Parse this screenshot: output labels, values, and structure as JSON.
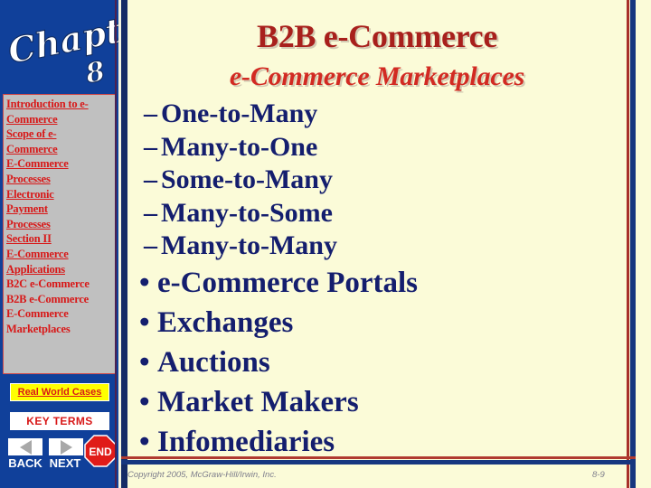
{
  "colors": {
    "sidebar_blue": "#10409a",
    "toc_background": "#c0c0c0",
    "link_red": "#d81818",
    "title_dark_red": "#a8201c",
    "subtitle_red": "#d22a22",
    "bullet_navy": "#141e6e",
    "slide_background": "#fbfbd8",
    "highlight_yellow": "#ffff00",
    "end_button_red": "#e01b18"
  },
  "sidebar": {
    "chapter_art": {
      "word": "Chapter",
      "number": "8",
      "icon": "chapter-script-art"
    },
    "toc_items": [
      {
        "label": "Introduction to e-",
        "underlined": true
      },
      {
        "label": "Commerce",
        "underlined": true
      },
      {
        "label": "Scope of e-",
        "underlined": true
      },
      {
        "label": "Commerce",
        "underlined": true
      },
      {
        "label": "E-Commerce",
        "underlined": true
      },
      {
        "label": "Processes",
        "underlined": true
      },
      {
        "label": "Electronic",
        "underlined": true
      },
      {
        "label": "Payment",
        "underlined": true
      },
      {
        "label": "Processes",
        "underlined": true
      },
      {
        "label": "Section II",
        "underlined": true
      },
      {
        "label": "E-Commerce",
        "underlined": true
      },
      {
        "label": "Applications",
        "underlined": true
      },
      {
        "label": "B2C e-Commerce",
        "underlined": false
      },
      {
        "label": "B2B e-Commerce",
        "underlined": false
      },
      {
        "label": "E-Commerce",
        "underlined": false
      },
      {
        "label": "Marketplaces",
        "underlined": false
      }
    ],
    "real_world_cases_label": "Real World Cases",
    "key_terms_label": "KEY TERMS",
    "back_label": "BACK",
    "next_label": "NEXT",
    "end_label": "END",
    "back_icon": "triangle-left-icon",
    "next_icon": "triangle-right-icon",
    "end_icon": "stop-octagon-icon"
  },
  "content": {
    "title": "B2B e-Commerce",
    "subtitle": "e-Commerce Marketplaces",
    "sub_items": [
      {
        "marker": "–",
        "label": "One-to-Many"
      },
      {
        "marker": "–",
        "label": "Many-to-One"
      },
      {
        "marker": "–",
        "label": "Some-to-Many"
      },
      {
        "marker": "–",
        "label": "Many-to-Some"
      },
      {
        "marker": "–",
        "label": "Many-to-Many"
      }
    ],
    "main_items": [
      {
        "marker": "•",
        "label": "e-Commerce Portals"
      },
      {
        "marker": "•",
        "label": "Exchanges"
      },
      {
        "marker": "•",
        "label": "Auctions"
      },
      {
        "marker": "•",
        "label": "Market Makers"
      },
      {
        "marker": "•",
        "label": "Infomediaries"
      }
    ]
  },
  "footer": {
    "copyright": "Copyright 2005, McGraw-Hill/Irwin, Inc.",
    "page_number": "8-9"
  }
}
